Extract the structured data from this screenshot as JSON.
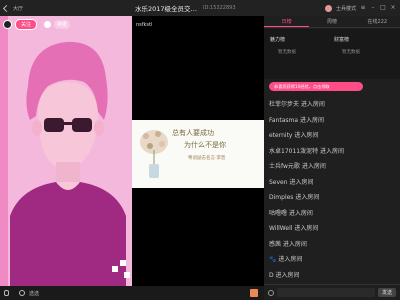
{
  "titlebar": {
    "back_label": "大厅",
    "room_title": "水乐2017级全员交…",
    "room_id": "ID:15322893",
    "user_name": "士兵楼式"
  },
  "streamer": {
    "follow_label": "关注",
    "fans_label": "排麦"
  },
  "left_bottom": {
    "mode_label": "选选"
  },
  "video": {
    "label": "nsfkstl",
    "poster_line1": "总有人要成功",
    "poster_line2": "为什么不是你",
    "poster_line3": "粤语励志名言·李晋"
  },
  "sidebar": {
    "tabs": [
      "日榜",
      "周榜",
      "在线222"
    ],
    "rank_left_title": "魅力榜",
    "rank_right_title": "财富榜",
    "rank_empty_text": "暂无数据",
    "notice": "恭喜您获得10经验，点击领取",
    "chat_items": [
      "杜菲尔步夫 进入房间",
      "Fantasma 进入房间",
      "eternity 进入房间",
      "水卓17011泼泥特 进入房间",
      "士兵fw元歌 进入房间",
      "Seven 进入房间",
      "Dimples 进入房间",
      "咕噜噜 进入房间",
      "WillWell 进入房间",
      "感茜 进入房间",
      "🐾 进入房间",
      "D 进入房间"
    ],
    "input_placeholder": "",
    "send_label": "发送"
  },
  "colors": {
    "accent": "#ff4d88",
    "camera_bg": "#f4b8dc"
  }
}
